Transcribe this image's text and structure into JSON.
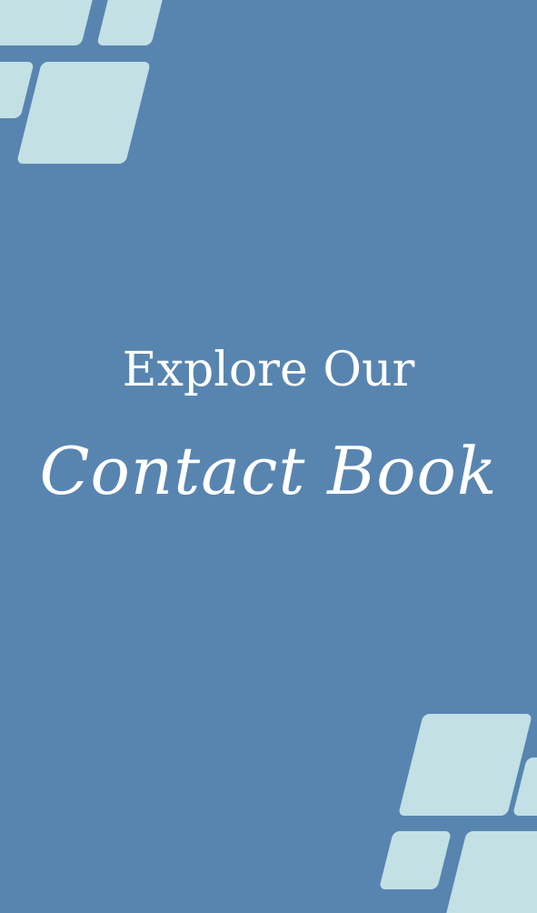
{
  "poster": {
    "headline": "Explore Our",
    "script_title": "Contact Book"
  },
  "colors": {
    "background": "#5885b0",
    "tiles": "#c3e0e5",
    "text": "#ffffff"
  }
}
